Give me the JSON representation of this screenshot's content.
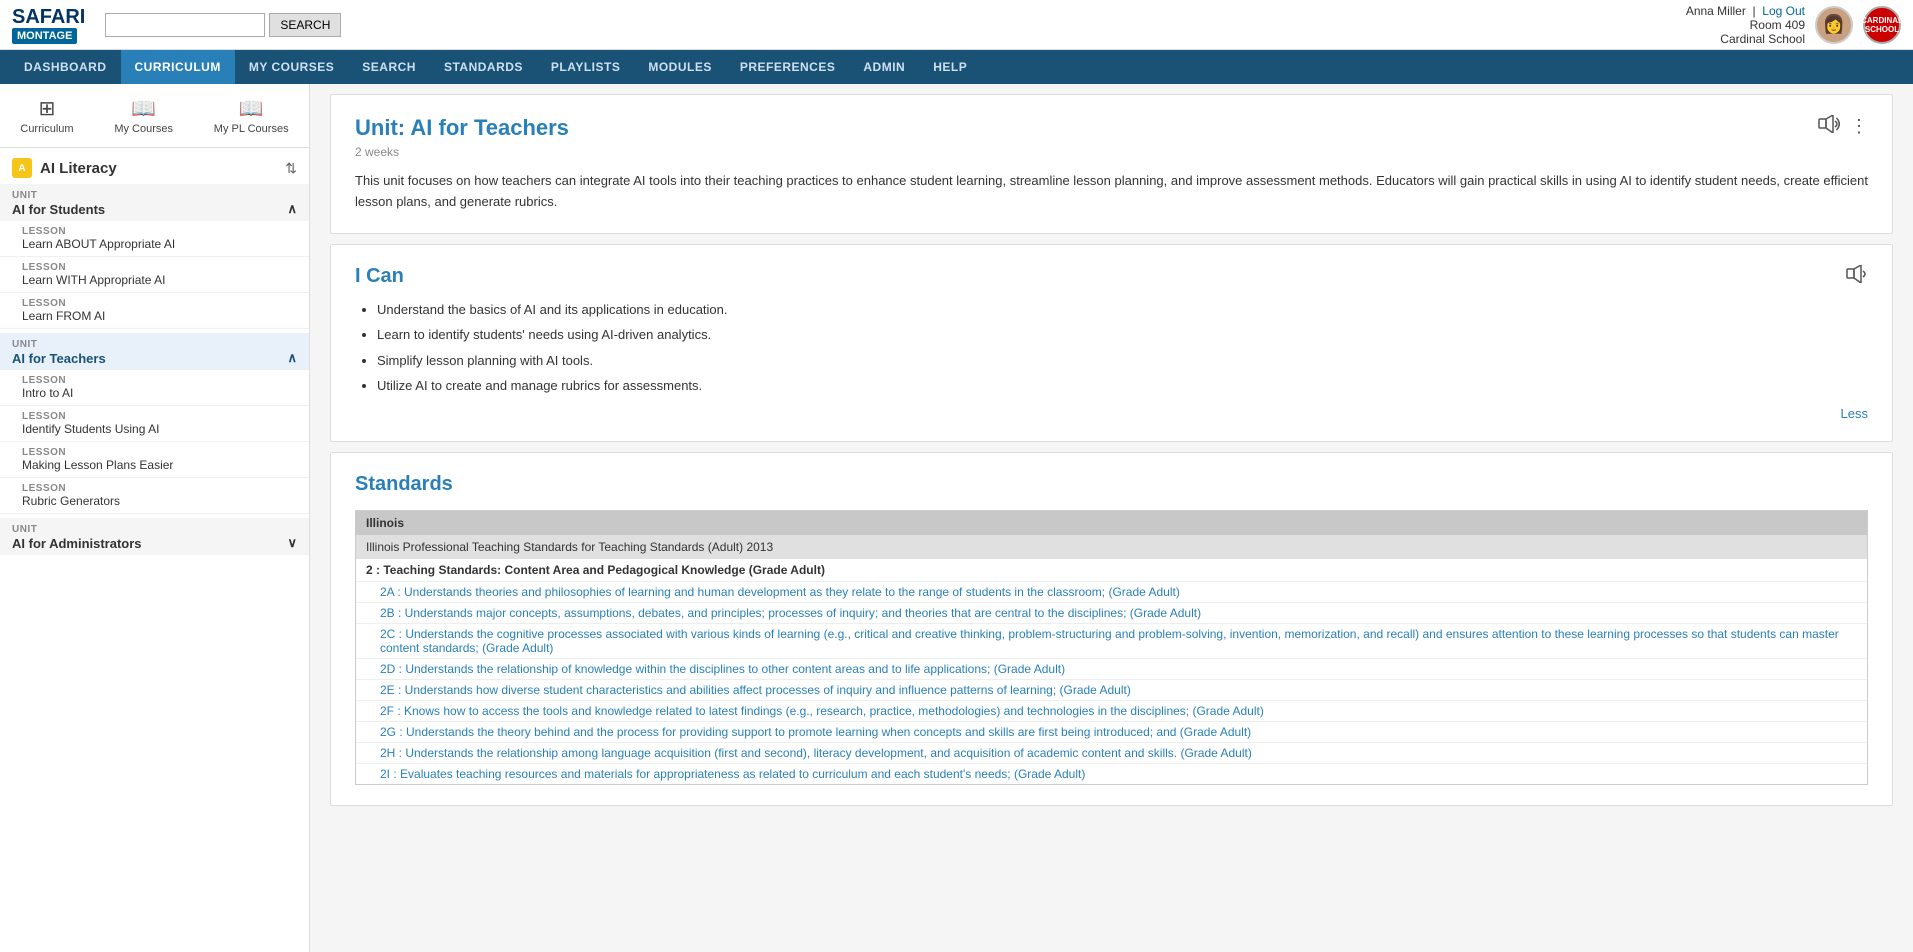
{
  "top_bar": {
    "logo_safari": "SAFARI",
    "logo_montage": "MONTAGE",
    "search_placeholder": "",
    "search_button": "SEARCH",
    "user_name": "Anna Miller",
    "user_action": "Log Out",
    "user_room": "Room 409",
    "user_school": "Cardinal School"
  },
  "nav": {
    "items": [
      {
        "label": "DASHBOARD",
        "active": false
      },
      {
        "label": "CURRICULUM",
        "active": true
      },
      {
        "label": "MY COURSES",
        "active": false
      },
      {
        "label": "SEARCH",
        "active": false
      },
      {
        "label": "STANDARDS",
        "active": false
      },
      {
        "label": "PLAYLISTS",
        "active": false
      },
      {
        "label": "MODULES",
        "active": false
      },
      {
        "label": "PREFERENCES",
        "active": false
      },
      {
        "label": "ADMIN",
        "active": false
      },
      {
        "label": "HELP",
        "active": false
      }
    ]
  },
  "sidebar": {
    "nav_items": [
      {
        "label": "Curriculum",
        "icon": "⊞"
      },
      {
        "label": "My Courses",
        "icon": "📖"
      },
      {
        "label": "My PL Courses",
        "icon": "📖"
      }
    ],
    "course_title": "AI Literacy",
    "units": [
      {
        "type": "unit",
        "label": "UNIT",
        "title": "AI for Students",
        "expanded": true,
        "selected": false,
        "lessons": [
          {
            "label": "LESSON",
            "title": "Learn ABOUT Appropriate AI"
          },
          {
            "label": "LESSON",
            "title": "Learn WITH Appropriate AI"
          },
          {
            "label": "LESSON",
            "title": "Learn FROM AI"
          }
        ]
      },
      {
        "type": "unit",
        "label": "UNIT",
        "title": "AI for Teachers",
        "expanded": true,
        "selected": true,
        "lessons": [
          {
            "label": "LESSON",
            "title": "Intro to AI"
          },
          {
            "label": "LESSON",
            "title": "Identify Students Using AI"
          },
          {
            "label": "LESSON",
            "title": "Making Lesson Plans Easier"
          },
          {
            "label": "LESSON",
            "title": "Rubric Generators"
          }
        ]
      },
      {
        "type": "unit",
        "label": "UNIT",
        "title": "AI for Administrators",
        "expanded": false,
        "selected": false,
        "lessons": []
      }
    ]
  },
  "content": {
    "unit_title": "Unit: AI for Teachers",
    "duration": "2 weeks",
    "description": "This unit focuses on how teachers can integrate AI tools into their teaching practices to enhance student learning, streamline lesson planning, and improve assessment methods. Educators will gain practical skills in using AI to identify student needs, create efficient lesson plans, and generate rubrics.",
    "i_can_title": "I Can",
    "i_can_items": [
      "Understand the basics of AI and its applications in education.",
      "Learn to identify students' needs using AI-driven analytics.",
      "Simplify lesson planning with AI tools.",
      "Utilize AI to create and manage rubrics for assessments."
    ],
    "less_label": "Less",
    "standards_title": "Standards",
    "standards": {
      "state": "Illinois",
      "group": "Illinois Professional Teaching Standards for Teaching Standards (Adult) 2013",
      "items": [
        {
          "level": "group",
          "text": "2 : Teaching Standards: Content Area and Pedagogical Knowledge (Grade Adult)"
        },
        {
          "level": "sub",
          "text": "2A : Understands theories and philosophies of learning and human development as they relate to the range of students in the classroom; (Grade Adult)"
        },
        {
          "level": "sub",
          "text": "2B : Understands major concepts, assumptions, debates, and principles; processes of inquiry; and theories that are central to the disciplines; (Grade Adult)"
        },
        {
          "level": "sub",
          "text": "2C : Understands the cognitive processes associated with various kinds of learning (e.g., critical and creative thinking, problem-structuring and problem-solving, invention, memorization, and recall) and ensures attention to these learning processes so that students can master content standards; (Grade Adult)"
        },
        {
          "level": "sub",
          "text": "2D : Understands the relationship of knowledge within the disciplines to other content areas and to life applications; (Grade Adult)"
        },
        {
          "level": "sub",
          "text": "2E : Understands how diverse student characteristics and abilities affect processes of inquiry and influence patterns of learning; (Grade Adult)"
        },
        {
          "level": "sub",
          "text": "2F : Knows how to access the tools and knowledge related to latest findings (e.g., research, practice, methodologies) and technologies in the disciplines; (Grade Adult)"
        },
        {
          "level": "sub",
          "text": "2G : Understands the theory behind and the process for providing support to promote learning when concepts and skills are first being introduced; and (Grade Adult)"
        },
        {
          "level": "sub",
          "text": "2H : Understands the relationship among language acquisition (first and second), literacy development, and acquisition of academic content and skills. (Grade Adult)"
        },
        {
          "level": "sub",
          "text": "2I : Evaluates teaching resources and materials for appropriateness as related to curriculum and each student's needs; (Grade Adult)"
        }
      ]
    }
  }
}
